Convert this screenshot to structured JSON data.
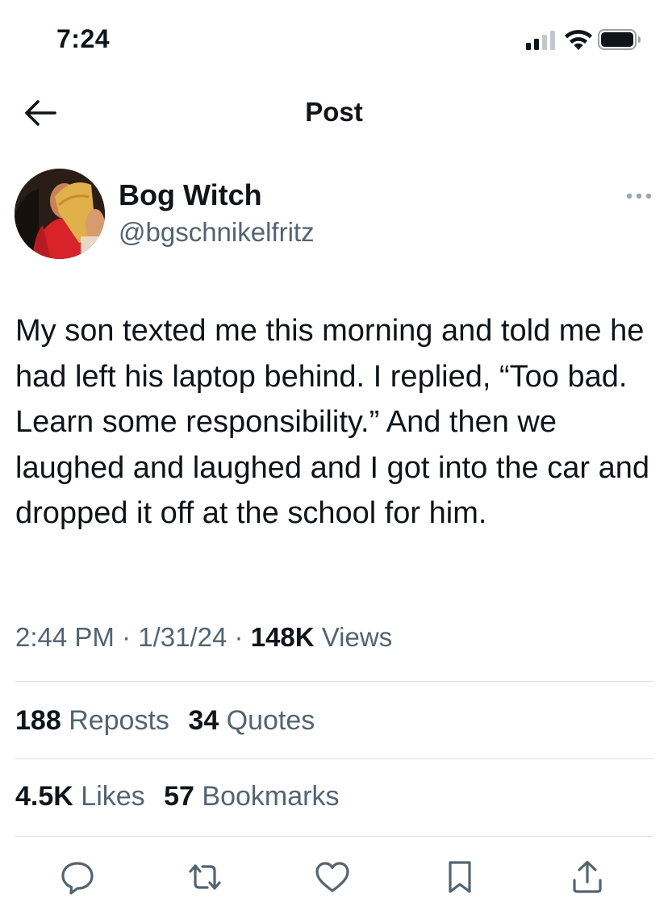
{
  "status_bar": {
    "time": "7:24"
  },
  "header": {
    "title": "Post"
  },
  "author": {
    "display_name": "Bog Witch",
    "handle": "@bgschnikelfritz"
  },
  "post": {
    "text": "My son texted me this morning and told me he had left his laptop behind. I replied, “Too bad. Learn some responsibility.” And then we laughed and laughed and I got into the car and dropped it off at the school for him.",
    "time": "2:44 PM",
    "date": "1/31/24",
    "separator": "·",
    "views_count": "148K",
    "views_label": "Views"
  },
  "stats": {
    "reposts_count": "188",
    "reposts_label": "Reposts",
    "quotes_count": "34",
    "quotes_label": "Quotes",
    "likes_count": "4.5K",
    "likes_label": "Likes",
    "bookmarks_count": "57",
    "bookmarks_label": "Bookmarks"
  },
  "actions": [
    "reply-icon",
    "repost-icon",
    "like-icon",
    "bookmark-icon",
    "share-icon"
  ],
  "colors": {
    "text": "#0f1419",
    "secondary": "#536471",
    "icon": "#536471",
    "divider": "#dcdfe2"
  }
}
